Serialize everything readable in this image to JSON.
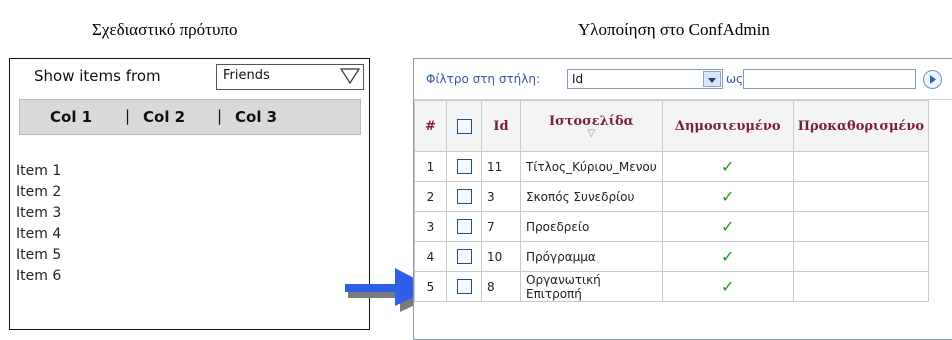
{
  "captions": {
    "left": "Σχεδιαστικό πρότυπο",
    "right": "Υλοποίηση στο ConfAdmin"
  },
  "mockup": {
    "filter_label": "Show items from",
    "filter_value": "Friends",
    "columns": [
      "Col 1",
      "Col 2",
      "Col 3"
    ],
    "separator": "|",
    "items": [
      "Item 1",
      "Item 2",
      "Item 3",
      "Item 4",
      "Item 5",
      "Item 6"
    ]
  },
  "conf": {
    "filter_label": "Φίλτρο στη στήλη:",
    "filter_column": "Id",
    "filter_as": "ως:",
    "filter_value": "",
    "headers": {
      "num": "#",
      "id": "Id",
      "site": "Ιστοσελίδα",
      "published": "Δημοσιευμένο",
      "default": "Προκαθορισμένο"
    },
    "rows": [
      {
        "num": "1",
        "id": "11",
        "site": "Τίτλος_Κύριου_Μενου",
        "published": "✓"
      },
      {
        "num": "2",
        "id": "3",
        "site": "Σκοπός Συνεδρίου",
        "published": "✓"
      },
      {
        "num": "3",
        "id": "7",
        "site": "Προεδρείο",
        "published": "✓"
      },
      {
        "num": "4",
        "id": "10",
        "site": "Πρόγραμμα",
        "published": "✓"
      },
      {
        "num": "5",
        "id": "8",
        "site": "Οργανωτική Επιτροπή",
        "published": "✓"
      }
    ]
  },
  "colors": {
    "arrow": "#2f5fe8",
    "header_text": "#7a1e3a",
    "tick": "#1a9a1a",
    "filter_text": "#3a5aa8"
  }
}
